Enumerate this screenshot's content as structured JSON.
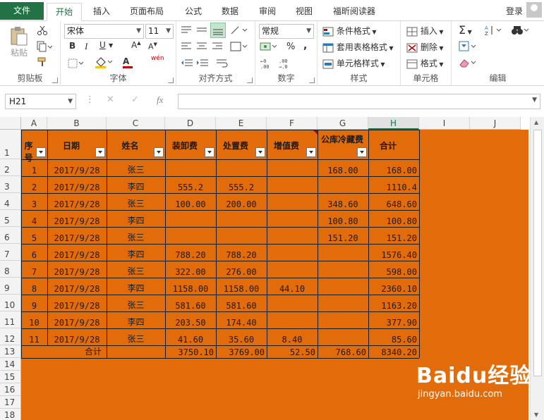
{
  "tabs": {
    "file": "文件",
    "home": "开始",
    "insert": "插入",
    "layout": "页面布局",
    "formulas": "公式",
    "data": "数据",
    "review": "审阅",
    "view": "视图",
    "reader": "福昕阅读器"
  },
  "login": "登录",
  "ribbon": {
    "clipboard": {
      "label": "剪贴板",
      "paste": "粘贴"
    },
    "font": {
      "label": "字体",
      "name": "宋体",
      "size": "11",
      "bold": "B",
      "italic": "I",
      "underline": "U",
      "grow": "A",
      "shrink": "A",
      "wen": "wén",
      "color_a": "A"
    },
    "align": {
      "label": "对齐方式"
    },
    "number": {
      "label": "数字",
      "format": "常规",
      "percent": "%",
      "comma": ","
    },
    "styles": {
      "label": "样式",
      "conditional": "条件格式",
      "table": "套用表格格式",
      "cell": "单元格样式"
    },
    "cells": {
      "label": "单元格",
      "insert": "插入",
      "delete": "删除",
      "format": "格式"
    },
    "editing": {
      "label": "编辑"
    }
  },
  "formula_bar": {
    "name_box": "H21",
    "fx": "fx",
    "value": ""
  },
  "columns": [
    "A",
    "B",
    "C",
    "D",
    "E",
    "F",
    "G",
    "H",
    "I",
    "J"
  ],
  "rows": [
    "1",
    "2",
    "3",
    "4",
    "5",
    "6",
    "7",
    "8",
    "9",
    "10",
    "11",
    "12",
    "13",
    "14",
    "15",
    "16",
    "17",
    "18"
  ],
  "table": {
    "headers": [
      "序号",
      "日期",
      "姓名",
      "装卸费",
      "处置费",
      "增值费",
      "公库冷藏费",
      "合计"
    ],
    "rows": [
      [
        "1",
        "2017/9/28",
        "张三",
        "",
        "",
        "",
        "168.00",
        "168.00"
      ],
      [
        "2",
        "2017/9/28",
        "李四",
        "555.2",
        "555.2",
        "",
        "",
        "1110.4"
      ],
      [
        "3",
        "2017/9/28",
        "张三",
        "100.00",
        "200.00",
        "",
        "348.60",
        "648.60"
      ],
      [
        "4",
        "2017/9/28",
        "李四",
        "",
        "",
        "",
        "100.80",
        "100.80"
      ],
      [
        "5",
        "2017/9/28",
        "张三",
        "",
        "",
        "",
        "151.20",
        "151.20"
      ],
      [
        "6",
        "2017/9/28",
        "李四",
        "788.20",
        "788.20",
        "",
        "",
        "1576.40"
      ],
      [
        "7",
        "2017/9/28",
        "张三",
        "322.00",
        "276.00",
        "",
        "",
        "598.00"
      ],
      [
        "8",
        "2017/9/28",
        "李四",
        "1158.00",
        "1158.00",
        "44.10",
        "",
        "2360.10"
      ],
      [
        "9",
        "2017/9/28",
        "张三",
        "581.60",
        "581.60",
        "",
        "",
        "1163.20"
      ],
      [
        "10",
        "2017/9/28",
        "李四",
        "203.50",
        "174.40",
        "",
        "",
        "377.90"
      ],
      [
        "11",
        "2017/9/28",
        "张三",
        "41.60",
        "35.60",
        "8.40",
        "",
        "85.60"
      ]
    ],
    "total_label": "合计",
    "totals": [
      "3750.10",
      "3769.00",
      "52.50",
      "768.60",
      "8340.20"
    ]
  },
  "watermark": {
    "brand": "Baidu经验",
    "url": "jingyan.baidu.com"
  }
}
